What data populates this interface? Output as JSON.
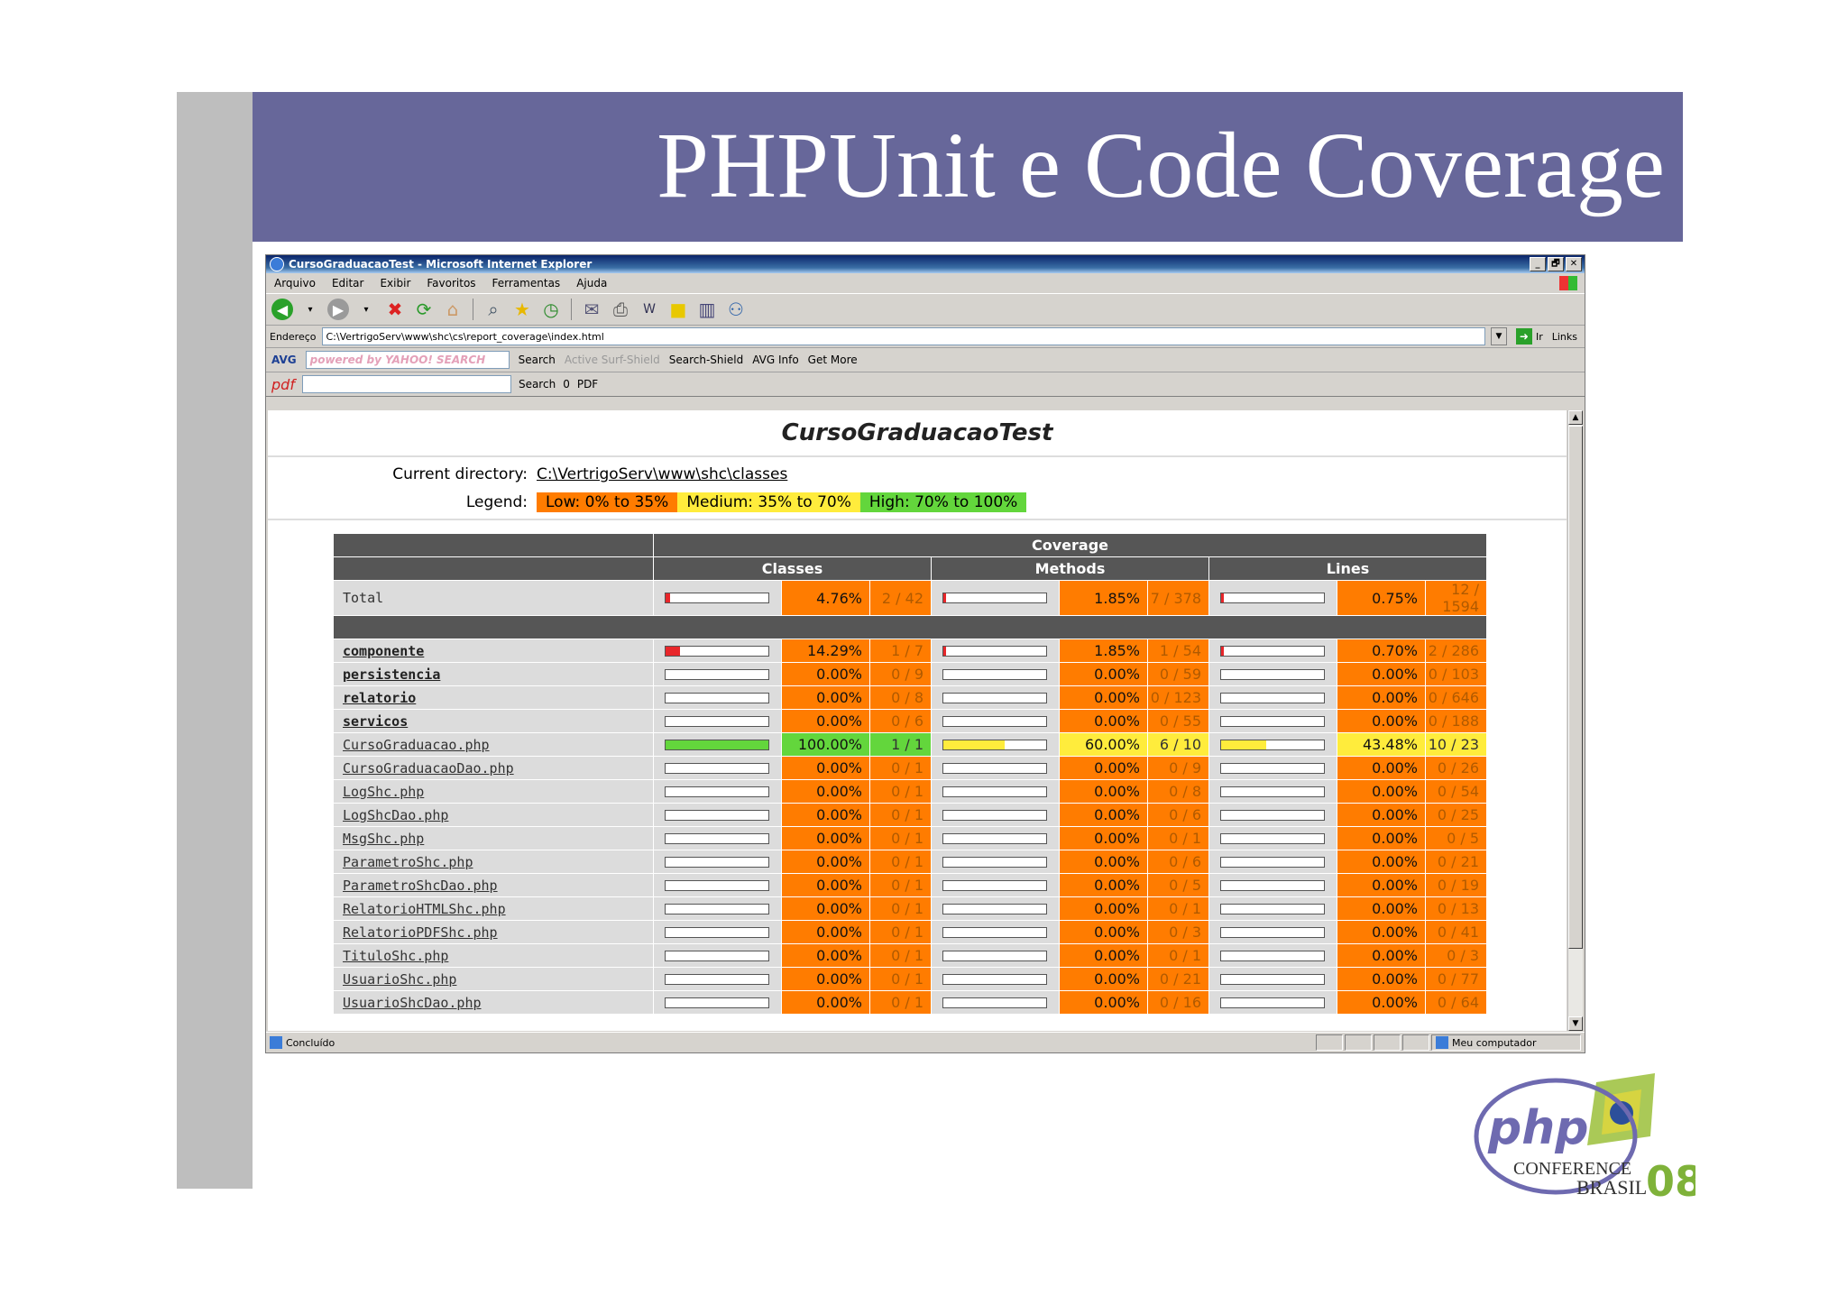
{
  "slide": {
    "title": "PHPUnit e Code Coverage",
    "logo": {
      "text_php": "php",
      "text_conference": "CONFERENCE",
      "text_brasil": "BRASIL",
      "text_year": "08"
    }
  },
  "window": {
    "title": "CursoGraduacaoTest - Microsoft Internet Explorer",
    "controls": [
      "_",
      "🗗",
      "✕"
    ]
  },
  "menu": [
    "Arquivo",
    "Editar",
    "Exibir",
    "Favoritos",
    "Ferramentas",
    "Ajuda"
  ],
  "address": {
    "label": "Endereço",
    "value": "C:\\VertrigoServ\\www\\shc\\cs\\report_coverage\\index.html",
    "go": "Ir",
    "links": "Links"
  },
  "toolbar2": {
    "avg": "AVG",
    "search_field": "powered by YAHOO! SEARCH",
    "search": "Search",
    "active_surf": "Active Surf-Shield",
    "search_shield": "Search-Shield",
    "avg_info": "AVG Info",
    "get_more": "Get More"
  },
  "toolbar3": {
    "pdf": "pdf",
    "search": "Search",
    "count": "0",
    "pdf_btn": "PDF"
  },
  "status": {
    "text": "Concluído",
    "zone": "Meu computador"
  },
  "report": {
    "title": "CursoGraduacaoTest",
    "current_dir_label": "Current directory:",
    "current_dir": "C:\\VertrigoServ\\www\\shc\\classes",
    "legend_label": "Legend:",
    "legend": {
      "low": "Low: 0% to 35%",
      "medium": "Medium: 35% to 70%",
      "high": "High: 70% to 100%"
    },
    "headers": {
      "coverage": "Coverage",
      "classes": "Classes",
      "methods": "Methods",
      "lines": "Lines"
    },
    "total": {
      "name": "Total",
      "classes": {
        "pct": "4.76%",
        "count": "2 / 42",
        "fill": 0.0476,
        "level": "lo"
      },
      "methods": {
        "pct": "1.85%",
        "count": "7 / 378",
        "fill": 0.0185,
        "level": "lo"
      },
      "lines": {
        "pct": "0.75%",
        "count": "12 / 1594",
        "fill": 0.0075,
        "level": "lo"
      }
    },
    "rows": [
      {
        "name": "componente",
        "dir": true,
        "classes": {
          "pct": "14.29%",
          "count": "1 / 7",
          "fill": 0.1429,
          "level": "lo"
        },
        "methods": {
          "pct": "1.85%",
          "count": "1 / 54",
          "fill": 0.0185,
          "level": "lo"
        },
        "lines": {
          "pct": "0.70%",
          "count": "2 / 286",
          "fill": 0.007,
          "level": "lo"
        }
      },
      {
        "name": "persistencia",
        "dir": true,
        "classes": {
          "pct": "0.00%",
          "count": "0 / 9",
          "fill": 0,
          "level": "lo"
        },
        "methods": {
          "pct": "0.00%",
          "count": "0 / 59",
          "fill": 0,
          "level": "lo"
        },
        "lines": {
          "pct": "0.00%",
          "count": "0 / 103",
          "fill": 0,
          "level": "lo"
        }
      },
      {
        "name": "relatorio",
        "dir": true,
        "classes": {
          "pct": "0.00%",
          "count": "0 / 8",
          "fill": 0,
          "level": "lo"
        },
        "methods": {
          "pct": "0.00%",
          "count": "0 / 123",
          "fill": 0,
          "level": "lo"
        },
        "lines": {
          "pct": "0.00%",
          "count": "0 / 646",
          "fill": 0,
          "level": "lo"
        }
      },
      {
        "name": "servicos",
        "dir": true,
        "classes": {
          "pct": "0.00%",
          "count": "0 / 6",
          "fill": 0,
          "level": "lo"
        },
        "methods": {
          "pct": "0.00%",
          "count": "0 / 55",
          "fill": 0,
          "level": "lo"
        },
        "lines": {
          "pct": "0.00%",
          "count": "0 / 188",
          "fill": 0,
          "level": "lo"
        }
      },
      {
        "name": "CursoGraduacao.php",
        "dir": false,
        "classes": {
          "pct": "100.00%",
          "count": "1 / 1",
          "fill": 1,
          "level": "hi"
        },
        "methods": {
          "pct": "60.00%",
          "count": "6 / 10",
          "fill": 0.6,
          "level": "me"
        },
        "lines": {
          "pct": "43.48%",
          "count": "10 / 23",
          "fill": 0.4348,
          "level": "me"
        }
      },
      {
        "name": "CursoGraduacaoDao.php",
        "dir": false,
        "classes": {
          "pct": "0.00%",
          "count": "0 / 1",
          "fill": 0,
          "level": "lo"
        },
        "methods": {
          "pct": "0.00%",
          "count": "0 / 9",
          "fill": 0,
          "level": "lo"
        },
        "lines": {
          "pct": "0.00%",
          "count": "0 / 26",
          "fill": 0,
          "level": "lo"
        }
      },
      {
        "name": "LogShc.php",
        "dir": false,
        "classes": {
          "pct": "0.00%",
          "count": "0 / 1",
          "fill": 0,
          "level": "lo"
        },
        "methods": {
          "pct": "0.00%",
          "count": "0 / 8",
          "fill": 0,
          "level": "lo"
        },
        "lines": {
          "pct": "0.00%",
          "count": "0 / 54",
          "fill": 0,
          "level": "lo"
        }
      },
      {
        "name": "LogShcDao.php",
        "dir": false,
        "classes": {
          "pct": "0.00%",
          "count": "0 / 1",
          "fill": 0,
          "level": "lo"
        },
        "methods": {
          "pct": "0.00%",
          "count": "0 / 6",
          "fill": 0,
          "level": "lo"
        },
        "lines": {
          "pct": "0.00%",
          "count": "0 / 25",
          "fill": 0,
          "level": "lo"
        }
      },
      {
        "name": "MsgShc.php",
        "dir": false,
        "classes": {
          "pct": "0.00%",
          "count": "0 / 1",
          "fill": 0,
          "level": "lo"
        },
        "methods": {
          "pct": "0.00%",
          "count": "0 / 1",
          "fill": 0,
          "level": "lo"
        },
        "lines": {
          "pct": "0.00%",
          "count": "0 / 5",
          "fill": 0,
          "level": "lo"
        }
      },
      {
        "name": "ParametroShc.php",
        "dir": false,
        "classes": {
          "pct": "0.00%",
          "count": "0 / 1",
          "fill": 0,
          "level": "lo"
        },
        "methods": {
          "pct": "0.00%",
          "count": "0 / 6",
          "fill": 0,
          "level": "lo"
        },
        "lines": {
          "pct": "0.00%",
          "count": "0 / 21",
          "fill": 0,
          "level": "lo"
        }
      },
      {
        "name": "ParametroShcDao.php",
        "dir": false,
        "classes": {
          "pct": "0.00%",
          "count": "0 / 1",
          "fill": 0,
          "level": "lo"
        },
        "methods": {
          "pct": "0.00%",
          "count": "0 / 5",
          "fill": 0,
          "level": "lo"
        },
        "lines": {
          "pct": "0.00%",
          "count": "0 / 19",
          "fill": 0,
          "level": "lo"
        }
      },
      {
        "name": "RelatorioHTMLShc.php",
        "dir": false,
        "classes": {
          "pct": "0.00%",
          "count": "0 / 1",
          "fill": 0,
          "level": "lo"
        },
        "methods": {
          "pct": "0.00%",
          "count": "0 / 1",
          "fill": 0,
          "level": "lo"
        },
        "lines": {
          "pct": "0.00%",
          "count": "0 / 13",
          "fill": 0,
          "level": "lo"
        }
      },
      {
        "name": "RelatorioPDFShc.php",
        "dir": false,
        "classes": {
          "pct": "0.00%",
          "count": "0 / 1",
          "fill": 0,
          "level": "lo"
        },
        "methods": {
          "pct": "0.00%",
          "count": "0 / 3",
          "fill": 0,
          "level": "lo"
        },
        "lines": {
          "pct": "0.00%",
          "count": "0 / 41",
          "fill": 0,
          "level": "lo"
        }
      },
      {
        "name": "TituloShc.php",
        "dir": false,
        "classes": {
          "pct": "0.00%",
          "count": "0 / 1",
          "fill": 0,
          "level": "lo"
        },
        "methods": {
          "pct": "0.00%",
          "count": "0 / 1",
          "fill": 0,
          "level": "lo"
        },
        "lines": {
          "pct": "0.00%",
          "count": "0 / 3",
          "fill": 0,
          "level": "lo"
        }
      },
      {
        "name": "UsuarioShc.php",
        "dir": false,
        "classes": {
          "pct": "0.00%",
          "count": "0 / 1",
          "fill": 0,
          "level": "lo"
        },
        "methods": {
          "pct": "0.00%",
          "count": "0 / 21",
          "fill": 0,
          "level": "lo"
        },
        "lines": {
          "pct": "0.00%",
          "count": "0 / 77",
          "fill": 0,
          "level": "lo"
        }
      },
      {
        "name": "UsuarioShcDao.php",
        "dir": false,
        "classes": {
          "pct": "0.00%",
          "count": "0 / 1",
          "fill": 0,
          "level": "lo"
        },
        "methods": {
          "pct": "0.00%",
          "count": "0 / 16",
          "fill": 0,
          "level": "lo"
        },
        "lines": {
          "pct": "0.00%",
          "count": "0 / 64",
          "fill": 0,
          "level": "lo"
        }
      }
    ],
    "colors": {
      "low": "#ff7c00",
      "medium": "#ffec3c",
      "high": "#63d63c",
      "bar_low": "#e8262a"
    }
  }
}
